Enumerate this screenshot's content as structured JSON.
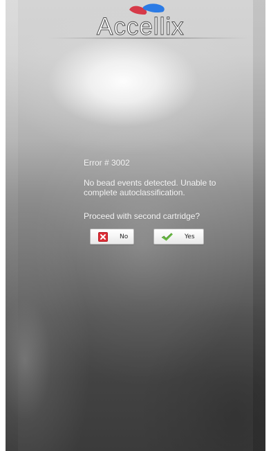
{
  "header": {
    "brand_name": "Accellix",
    "logo_icon": "accellix-logo-mark"
  },
  "dialog": {
    "error_code": "Error # 3002",
    "message_lines": [
      "No bead events detected. Unable to",
      "complete autoclassification."
    ],
    "question": "Proceed with second cartridge?",
    "buttons": {
      "no": {
        "label": "No",
        "icon": "close-icon"
      },
      "yes": {
        "label": "Yes",
        "icon": "check-icon"
      }
    }
  },
  "colors": {
    "panel_top": "#d2d2d2",
    "panel_bottom": "#3b3b3b",
    "text": "#f4f4f4",
    "logo_red": "#d63a49",
    "logo_blue": "#2c7be5",
    "button_face": "#f6f6f6",
    "no_icon_red": "#dd2d35",
    "yes_icon_green": "#69b943"
  }
}
